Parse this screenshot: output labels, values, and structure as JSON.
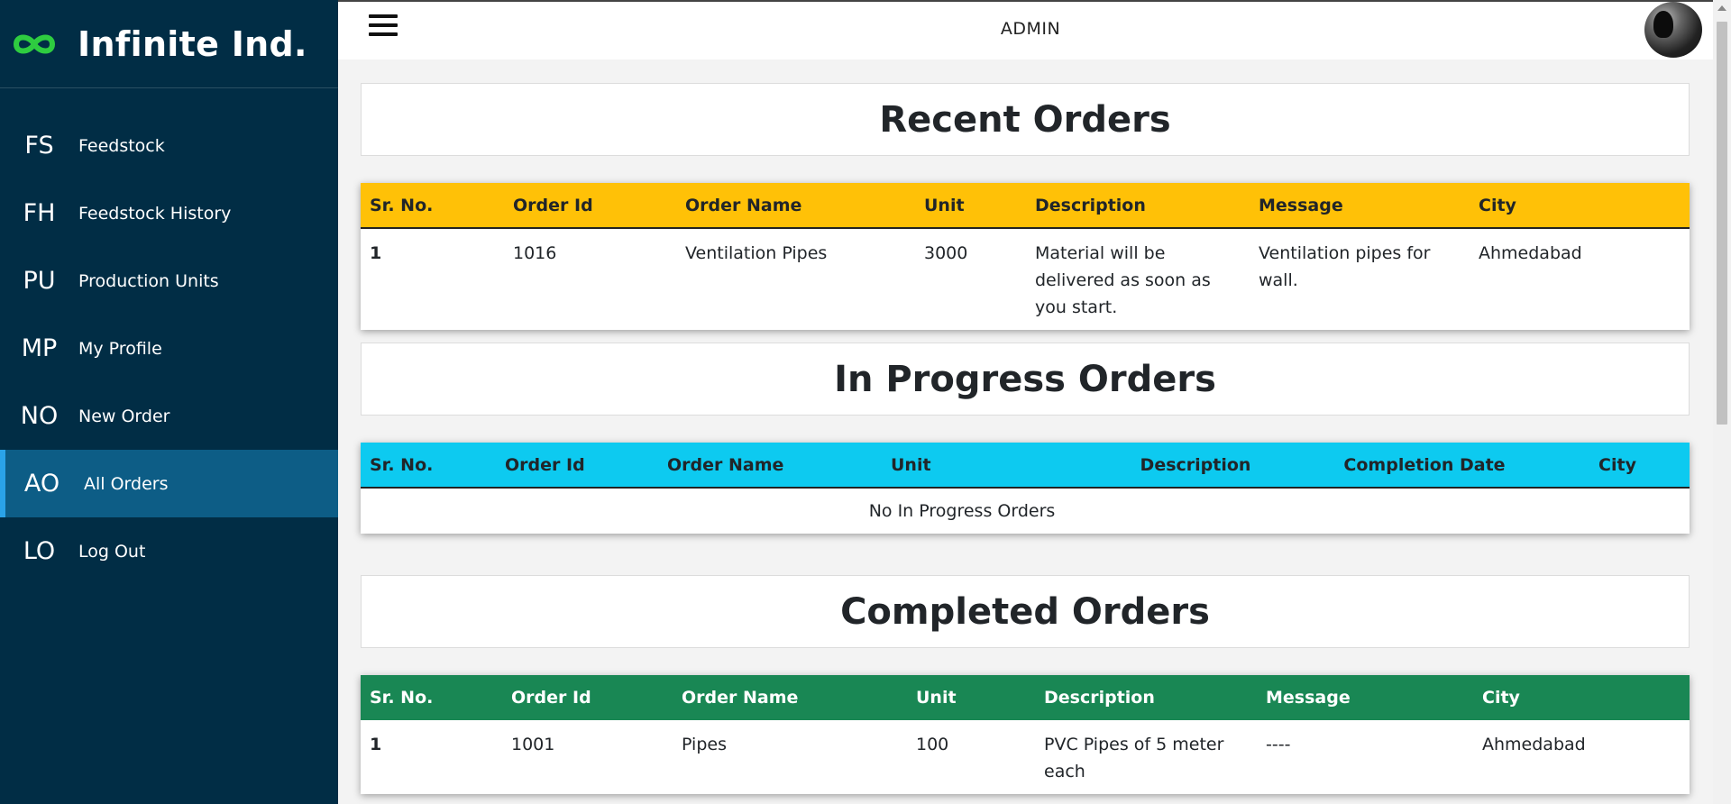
{
  "app": {
    "brand": "Infinite Ind.",
    "brand_color": "#2ecc40"
  },
  "sidebar": {
    "items": [
      {
        "abbr": "FS",
        "label": "Feedstock"
      },
      {
        "abbr": "FH",
        "label": "Feedstock History"
      },
      {
        "abbr": "PU",
        "label": "Production Units"
      },
      {
        "abbr": "MP",
        "label": "My Profile"
      },
      {
        "abbr": "NO",
        "label": "New Order"
      },
      {
        "abbr": "AO",
        "label": "All Orders",
        "active": true
      },
      {
        "abbr": "LO",
        "label": "Log Out"
      }
    ]
  },
  "header": {
    "user_role": "ADMIN",
    "menu_icon": "hamburger-icon",
    "avatar_icon": "avatar"
  },
  "recent_orders": {
    "title": "Recent Orders",
    "header_color": "#ffc107",
    "columns": [
      "Sr. No.",
      "Order Id",
      "Order Name",
      "Unit",
      "Description",
      "Message",
      "City"
    ],
    "rows": [
      [
        "1",
        "1016",
        "Ventilation Pipes",
        "3000",
        "Material will be delivered as soon as you start.",
        "Ventilation pipes for wall.",
        "Ahmedabad"
      ]
    ]
  },
  "in_progress_orders": {
    "title": "In Progress Orders",
    "header_color": "#0dcaf0",
    "columns": [
      "Sr. No.",
      "Order Id",
      "Order Name",
      "Unit",
      "Description",
      "Completion Date",
      "City"
    ],
    "empty_text": "No In Progress Orders"
  },
  "completed_orders": {
    "title": "Completed Orders",
    "header_color": "#198754",
    "columns": [
      "Sr. No.",
      "Order Id",
      "Order Name",
      "Unit",
      "Description",
      "Message",
      "City"
    ],
    "rows": [
      [
        "1",
        "1001",
        "Pipes",
        "100",
        "PVC Pipes of 5 meter each",
        "----",
        "Ahmedabad"
      ]
    ]
  }
}
